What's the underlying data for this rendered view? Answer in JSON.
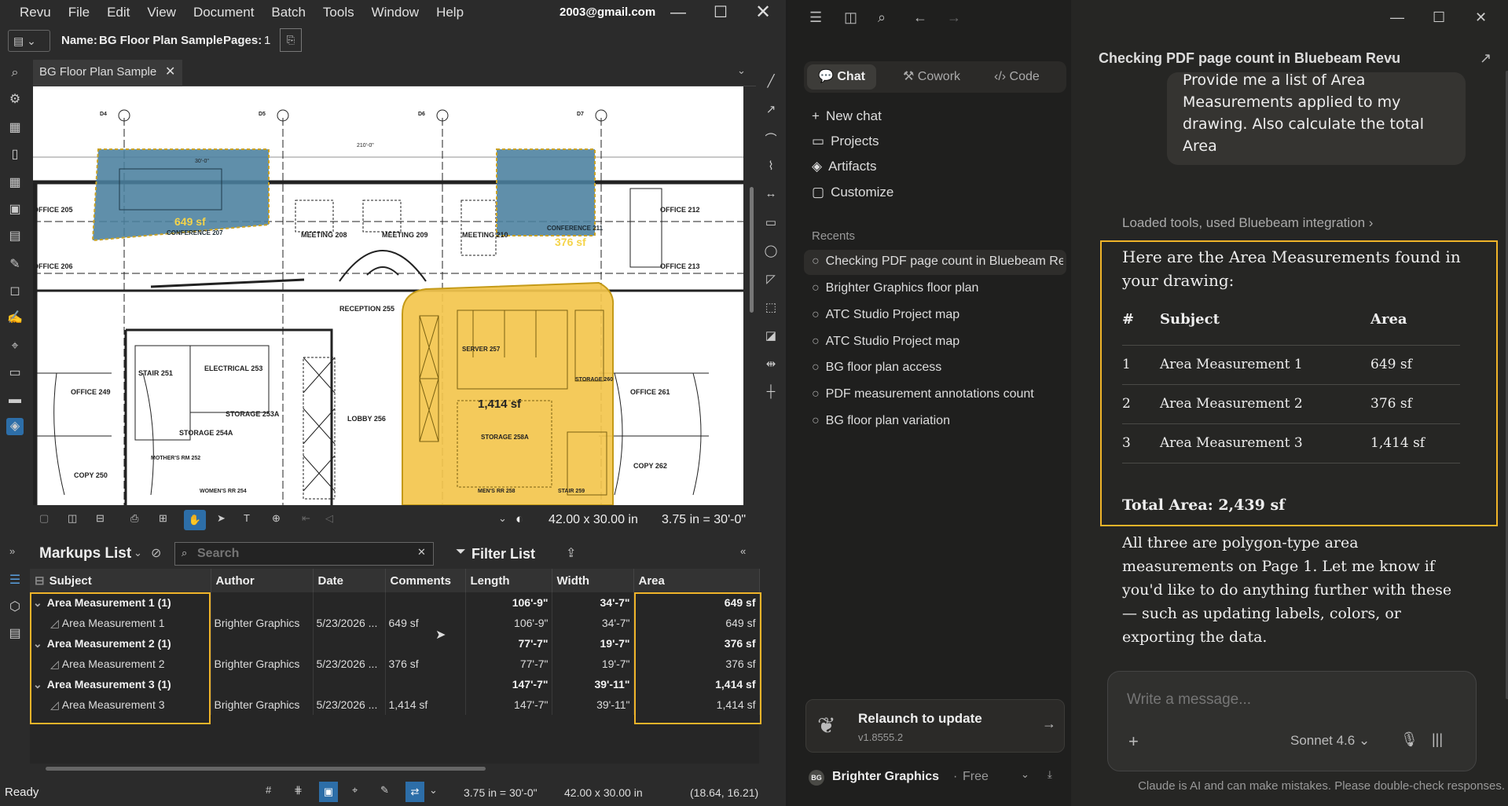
{
  "menubar": {
    "items": [
      "Revu",
      "File",
      "Edit",
      "View",
      "Document",
      "Batch",
      "Tools",
      "Window",
      "Help"
    ],
    "account": "2003@gmail.com"
  },
  "docbar": {
    "name_label": "Name:",
    "name_value": "BG Floor Plan Sample",
    "pages_label": "Pages:",
    "pages_value": "1"
  },
  "doc_tab": {
    "title": "BG Floor Plan Sample"
  },
  "drawing": {
    "rooms": [
      "OFFICE 205",
      "MEETING 208",
      "MEETING 209",
      "MEETING 210",
      "OFFICE 212",
      "OFFICE 206",
      "OFFICE 213",
      "RECEPTION 255",
      "CONFERENCE 207",
      "CONFERENCE 211",
      "STAIR 251",
      "ELECTRICAL 253",
      "STORAGE 253A",
      "STORAGE 254A",
      "LOBBY 256",
      "SERVER 257",
      "STORAGE 258A",
      "STORAGE 260",
      "OFFICE 261",
      "OFFICE 249",
      "COPY 250",
      "COPY 262",
      "WOMEN'S RR 254",
      "MEN'S RR 258",
      "STAIR 259",
      "MOTHER'S RM 252"
    ],
    "area_labels": [
      "649 sf",
      "376 sf",
      "1,414 sf"
    ],
    "dim_labels": [
      "210'-0\"",
      "30'-0\""
    ],
    "column_tags": [
      "D4",
      "D5",
      "D6",
      "D7"
    ]
  },
  "viewbar": {
    "page_size": "42.00 x 30.00 in",
    "scale": "3.75 in = 30'-0\""
  },
  "markups": {
    "title": "Markups List",
    "search_placeholder": "Search",
    "filter_label": "Filter List",
    "columns": [
      "Subject",
      "Author",
      "Date",
      "Comments",
      "Length",
      "Width",
      "Area"
    ],
    "rows": [
      {
        "group": true,
        "subject": "Area Measurement 1 (1)",
        "author": "",
        "date": "",
        "comments": "",
        "length": "106'-9\"",
        "width": "34'-7\"",
        "area": "649 sf"
      },
      {
        "group": false,
        "subject": "Area Measurement 1",
        "author": "Brighter Graphics",
        "date": "5/23/2026 ...",
        "comments": "649 sf",
        "length": "106'-9\"",
        "width": "34'-7\"",
        "area": "649 sf"
      },
      {
        "group": true,
        "subject": "Area Measurement 2 (1)",
        "author": "",
        "date": "",
        "comments": "",
        "length": "77'-7\"",
        "width": "19'-7\"",
        "area": "376 sf"
      },
      {
        "group": false,
        "subject": "Area Measurement 2",
        "author": "Brighter Graphics",
        "date": "5/23/2026 ...",
        "comments": "376 sf",
        "length": "77'-7\"",
        "width": "19'-7\"",
        "area": "376 sf"
      },
      {
        "group": true,
        "subject": "Area Measurement 3 (1)",
        "author": "",
        "date": "",
        "comments": "",
        "length": "147'-7\"",
        "width": "39'-11\"",
        "area": "1,414 sf"
      },
      {
        "group": false,
        "subject": "Area Measurement 3",
        "author": "Brighter Graphics",
        "date": "5/23/2026 ...",
        "comments": "1,414 sf",
        "length": "147'-7\"",
        "width": "39'-11\"",
        "area": "1,414 sf"
      }
    ]
  },
  "statusbar": {
    "status": "Ready",
    "scale": "3.75 in = 30'-0\"",
    "size": "42.00 x 30.00 in",
    "coords": "(18.64, 16.21)"
  },
  "claude": {
    "modes": [
      "Chat",
      "Cowork",
      "Code"
    ],
    "nav": [
      "New chat",
      "Projects",
      "Artifacts",
      "Customize"
    ],
    "recents_label": "Recents",
    "recents": [
      "Checking PDF page count in Bluebeam Revu",
      "Brighter Graphics floor plan",
      "ATC Studio Project map",
      "ATC Studio Project map",
      "BG floor plan access",
      "PDF measurement annotations count",
      "BG floor plan variation"
    ],
    "update_title": "Relaunch to update",
    "update_version": "v1.8555.2",
    "user_name": "Brighter Graphics",
    "user_plan": "Free",
    "user_initials": "BG",
    "conversation_title": "Checking PDF page count in Bluebeam Revu",
    "user_message": "Provide me a list of Area Measurements applied to my drawing. Also calculate the total Area",
    "tools_line": "Loaded tools, used Bluebeam integration",
    "answer_intro": "Here are the Area Measurements found in your drawing:",
    "table_headers": [
      "#",
      "Subject",
      "Area"
    ],
    "table_rows": [
      [
        "1",
        "Area Measurement 1",
        "649 sf"
      ],
      [
        "2",
        "Area Measurement 2",
        "376 sf"
      ],
      [
        "3",
        "Area Measurement 3",
        "1,414 sf"
      ]
    ],
    "total": "Total Area: 2,439 sf",
    "followup": "All three are polygon-type area measurements on Page 1. Let me know if you'd like to do anything further with these — such as updating labels, colors, or exporting the data.",
    "composer_placeholder": "Write a message...",
    "model": "Sonnet 4.6",
    "disclaimer": "Claude is AI and can make mistakes. Please double-check responses."
  },
  "colors": {
    "highlight": "#f0b429",
    "blue_area": "#4a7f9e",
    "yellow_area": "#f3c54d",
    "accent": "#d97757"
  }
}
